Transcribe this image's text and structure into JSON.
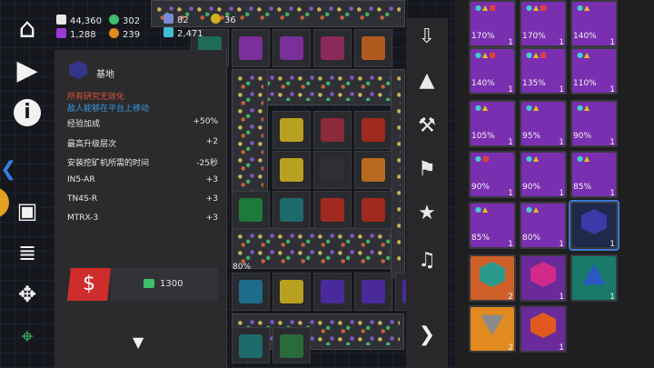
{
  "resources": {
    "money": "44,360",
    "research": "302",
    "purple": "1,288",
    "orange": "239"
  },
  "board_counters": {
    "a": "82",
    "b": "36",
    "c": "2,471"
  },
  "board_percent": "80%",
  "info_panel": {
    "title": "基地",
    "warning_1": "所有研究无效化",
    "warning_2": "敌人能够在平台上移动",
    "stats": [
      {
        "label": "经验加成",
        "value": "+50%"
      },
      {
        "label": "最高升级层次",
        "value": "+2"
      },
      {
        "label": "安装挖矿机所需的时间",
        "value": "-25秒"
      },
      {
        "label": "IN5-AR",
        "value": "+3"
      },
      {
        "label": "TN4S-R",
        "value": "+3"
      },
      {
        "label": "MTRX-3",
        "value": "+3"
      }
    ],
    "unlock_symbol": "$",
    "cost": "1300"
  },
  "icons": {
    "home": "home-icon",
    "play": "play-icon",
    "info": "info-icon",
    "tool_download": "download-tray-icon",
    "tool_road": "road-icon",
    "tool_pickaxe": "pickaxe-icon",
    "tool_flag": "flag-icon",
    "tool_star": "star-icon",
    "tool_music": "music-icon"
  },
  "colors": {
    "warning": "#e0533a",
    "info": "#3a97e0",
    "accent_red": "#cf2c2c",
    "selected_outline": "#3a7ad6",
    "slot_purple": "#7a2fb0"
  },
  "inventory": [
    {
      "pct": "170%",
      "qty": "1"
    },
    {
      "pct": "170%",
      "qty": "1"
    },
    {
      "pct": "140%",
      "qty": "1"
    },
    {
      "pct": "140%",
      "qty": "1"
    },
    {
      "pct": "135%",
      "qty": "1"
    },
    {
      "pct": "110%",
      "qty": "1"
    },
    {
      "pct": "105%",
      "qty": "1"
    },
    {
      "pct": "95%",
      "qty": "1"
    },
    {
      "pct": "90%",
      "qty": "1"
    },
    {
      "pct": "90%",
      "qty": "1"
    },
    {
      "pct": "90%",
      "qty": "1"
    },
    {
      "pct": "85%",
      "qty": "1"
    },
    {
      "pct": "85%",
      "qty": "1"
    },
    {
      "pct": "80%",
      "qty": "1"
    },
    {
      "pct": "",
      "qty": "1"
    },
    {
      "pct": "",
      "qty": "2"
    },
    {
      "pct": "",
      "qty": "1"
    },
    {
      "pct": "",
      "qty": "1"
    },
    {
      "pct": "",
      "qty": "2"
    },
    {
      "pct": "",
      "qty": "1"
    }
  ]
}
